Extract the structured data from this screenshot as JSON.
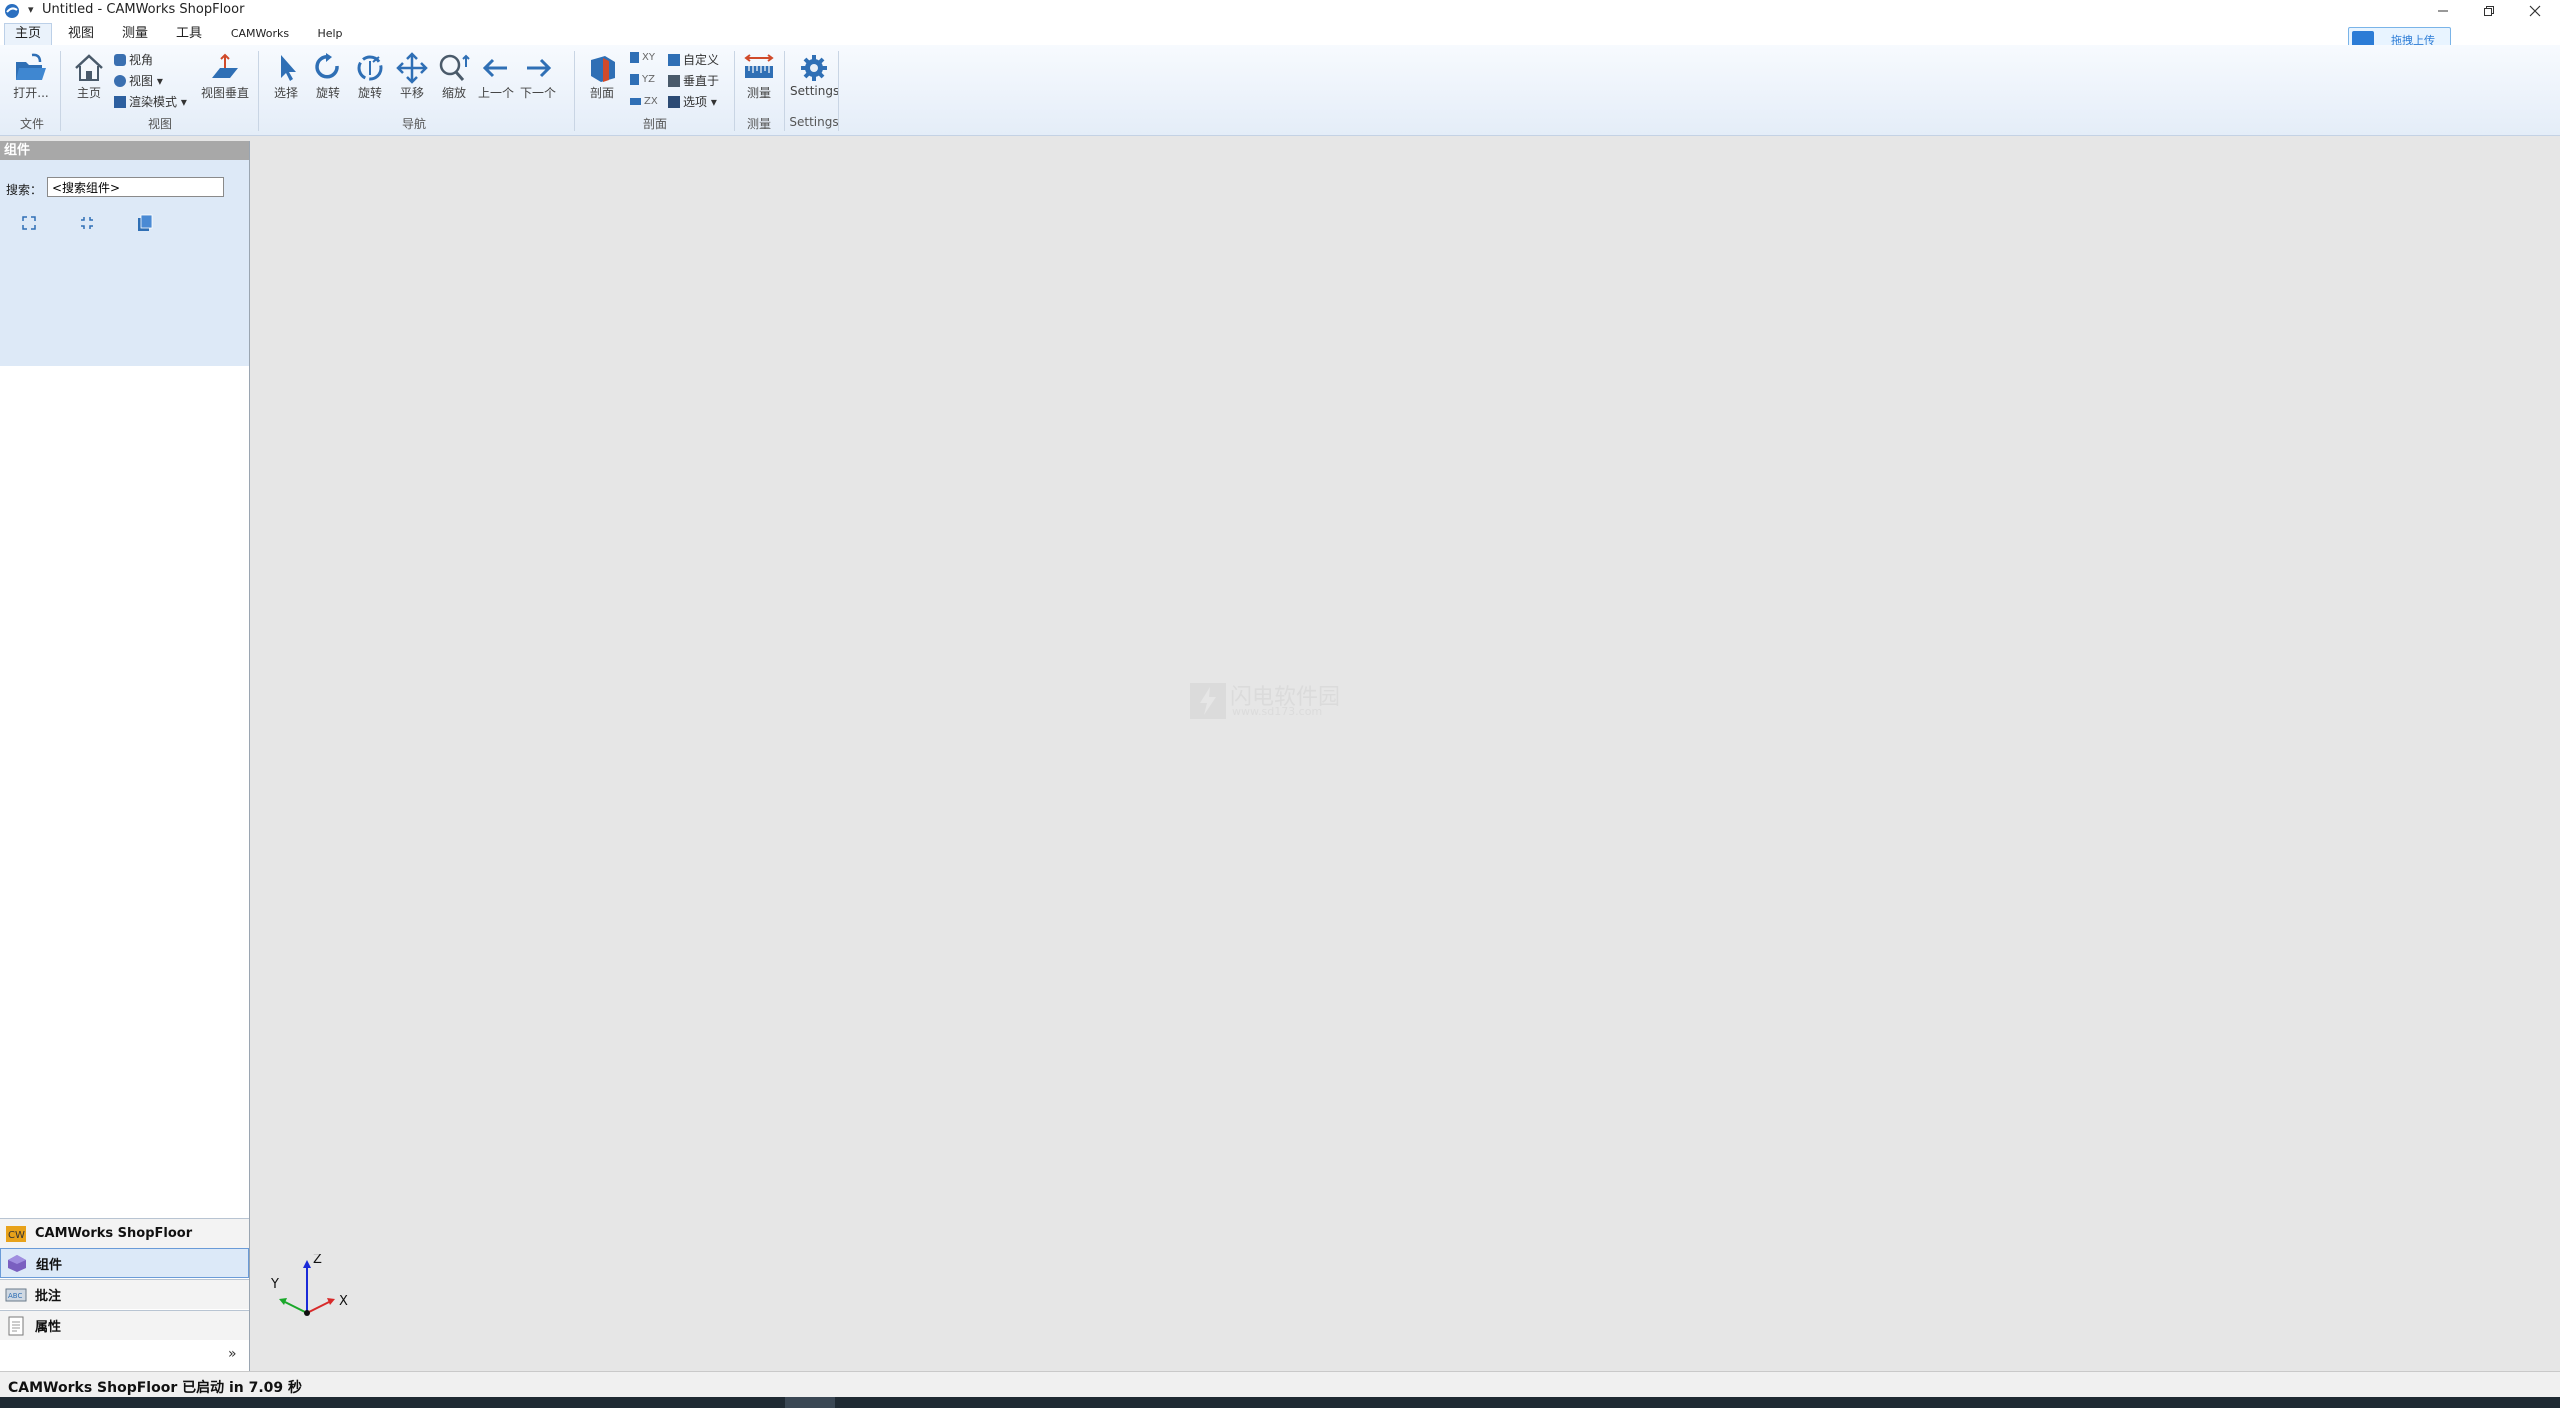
{
  "window": {
    "title": "Untitled - CAMWorks ShopFloor",
    "qa_arrow": "▾"
  },
  "tabs": [
    {
      "label": "主页"
    },
    {
      "label": "视图"
    },
    {
      "label": "测量"
    },
    {
      "label": "工具"
    },
    {
      "label": "CAMWorks"
    },
    {
      "label": "Help"
    }
  ],
  "upload_button": {
    "label": "拖拽上传"
  },
  "ribbon": {
    "file": {
      "open": "打开...",
      "group": "文件"
    },
    "view": {
      "home": "主页",
      "angle": "视角",
      "views": "视图 ▾",
      "render": "渲染模式 ▾",
      "normal": "视图垂直",
      "group": "视图"
    },
    "nav": {
      "select": "选择",
      "rotate1": "旋转",
      "rotate2": "旋转",
      "pan": "平移",
      "zoom": "缩放",
      "prev": "上一个",
      "next": "下一个",
      "group": "导航"
    },
    "section": {
      "section": "剖面",
      "xy": "XY",
      "yz": "YZ",
      "zx": "ZX",
      "custom": "自定义",
      "perp": "垂直于",
      "options": "选项 ▾",
      "group": "剖面"
    },
    "measure": {
      "measure": "测量",
      "group": "测量"
    },
    "settings": {
      "settings": "Settings",
      "group": "Settings"
    }
  },
  "left_panel": {
    "header": "组件",
    "search_label": "搜索：",
    "search_value": "<搜索组件>",
    "nav": [
      {
        "label": "CAMWorks ShopFloor"
      },
      {
        "label": "组件"
      },
      {
        "label": "批注"
      },
      {
        "label": "属性"
      }
    ],
    "chevron": "»"
  },
  "viewport": {
    "watermark_title": "闪电软件园",
    "watermark_url": "www.sd173.com",
    "axis_x": "X",
    "axis_y": "Y",
    "axis_z": "Z"
  },
  "status": {
    "text": "CAMWorks ShopFloor 已启动 in 7.09 秒"
  },
  "colors": {
    "accent": "#2c6db5",
    "panel_active": "#dce9f8",
    "ribbon_bg": "#e4edf8"
  }
}
